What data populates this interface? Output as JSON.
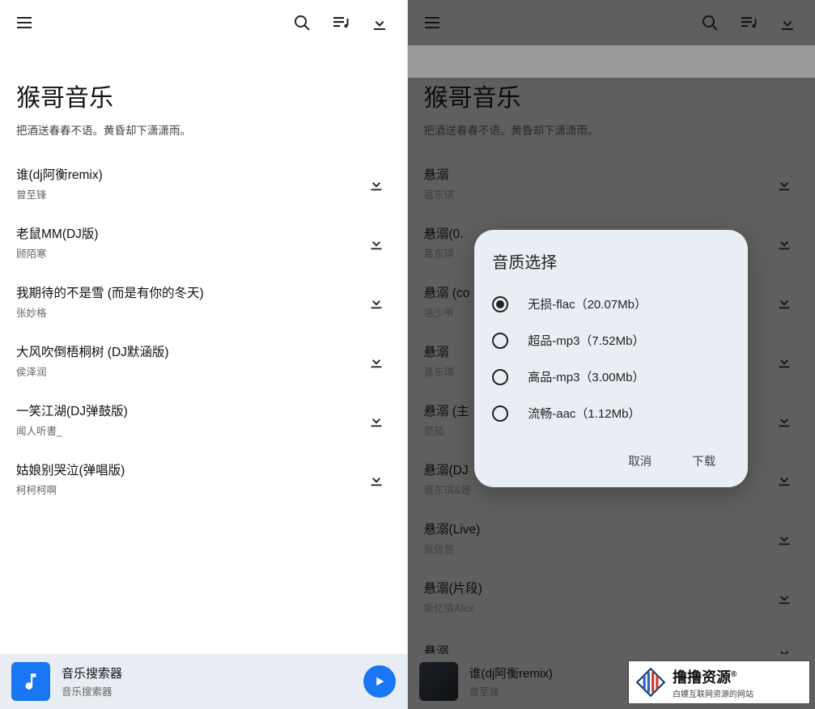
{
  "left": {
    "app_title": "猴哥音乐",
    "app_subtitle": "把酒送春春不语。黄昏却下潇潇雨。",
    "songs": [
      {
        "title": "谁(dj阿衡remix)",
        "artist": "曾至锋"
      },
      {
        "title": "老鼠MM(DJ版)",
        "artist": "顾陌寒"
      },
      {
        "title": "我期待的不是雪 (而是有你的冬天)",
        "artist": "张妙格"
      },
      {
        "title": "大风吹倒梧桐树 (DJ默涵版)",
        "artist": "侯泽润"
      },
      {
        "title": "一笑江湖(DJ弹鼓版)",
        "artist": "闻人听書_"
      },
      {
        "title": "姑娘别哭泣(弹唱版)",
        "artist": "柯柯柯啊"
      }
    ],
    "player": {
      "title": "音乐搜索器",
      "subtitle": "音乐搜索器"
    }
  },
  "right": {
    "app_title": "猴哥音乐",
    "app_subtitle": "把酒送春春不语。黄昏却下潇潇雨。",
    "songs": [
      {
        "title": "悬溺",
        "artist": "葛东琪"
      },
      {
        "title": "悬溺(0.",
        "artist": "葛东琪"
      },
      {
        "title": "悬溺 (co",
        "artist": "洛少爷"
      },
      {
        "title": "悬溺",
        "artist": "葛东琪"
      },
      {
        "title": "悬溺 (主",
        "artist": "范茹"
      },
      {
        "title": "悬溺(DJ",
        "artist": "葛东琪&是"
      },
      {
        "title": "悬溺(Live)",
        "artist": "张信哲"
      },
      {
        "title": "悬溺(片段)",
        "artist": "斯忆情Alex"
      },
      {
        "title": "悬溺",
        "artist": ""
      }
    ],
    "player": {
      "title": "谁(dj阿衡remix)",
      "subtitle": "曾至锋"
    },
    "dialog": {
      "title": "音质选择",
      "options": [
        {
          "label": "无损-flac（20.07Mb）",
          "selected": true
        },
        {
          "label": "超品-mp3（7.52Mb）",
          "selected": false
        },
        {
          "label": "高品-mp3（3.00Mb）",
          "selected": false
        },
        {
          "label": "流畅-aac（1.12Mb）",
          "selected": false
        }
      ],
      "cancel": "取消",
      "confirm": "下载"
    }
  },
  "watermark": {
    "main": "撸撸资源",
    "sup": "®",
    "sub": "白嫖互联网资源的网站"
  }
}
